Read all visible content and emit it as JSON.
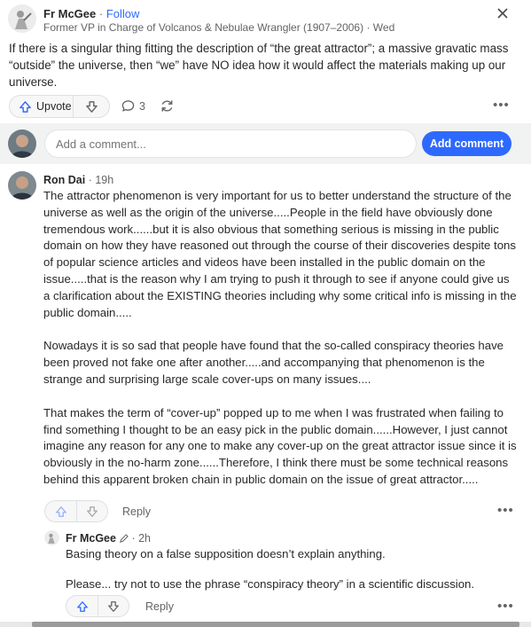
{
  "post": {
    "author": "Fr McGee",
    "follow_label": "Follow",
    "credential": "Former VP in Charge of Volcanos & Nebulae Wrangler (1907–2006)",
    "date": "Wed",
    "text": "If there is a singular thing fitting the description of “the great attractor”; a massive gravatic mass “outside” the universe, then “we” have NO idea how it would affect the materials making up our universe.",
    "upvote_label": "Upvote",
    "comment_count": "3"
  },
  "composer": {
    "placeholder": "Add a comment...",
    "button_label": "Add comment"
  },
  "comment": {
    "author": "Ron Dai",
    "time": "19h",
    "paragraphs": [
      "The attractor phenomenon is very important for us to better understand the structure of the universe as well as the origin of the universe.....People in the field have obviously done tremendous work......but it is also obvious that something serious is missing in the public domain on how they have reasoned out through the course of their discoveries despite tons of popular science articles and videos have been installed in the public domain on the issue.....that is the reason why I am trying to push it through to see if anyone could give us a clarification about the EXISTING theories including why some critical info is missing in the public domain.....",
      "Nowadays it is so sad that people have found that the so-called conspiracy theories have been proved not fake one after another.....and accompanying that phenomenon is the strange and surprising large scale cover-ups on many issues....",
      "That makes the term of “cover-up” popped up to me when I was frustrated when failing to find something I thought to be an easy pick in the public domain......However, I just cannot imagine any reason for any one to make any cover-up on the great attractor issue since it is obviously in the no-harm zone......Therefore, I think there must be some technical reasons behind this apparent broken chain in public domain on the issue of great attractor....."
    ],
    "reply_label": "Reply"
  },
  "reply": {
    "author": "Fr McGee",
    "time": "2h",
    "paragraphs": [
      "Basing theory on a false supposition doesn’t explain anything.",
      "Please... try not to use the phrase “conspiracy theory” in a scientific discussion."
    ],
    "reply_label": "Reply"
  },
  "colors": {
    "accent": "#2e69ff",
    "text": "#282829",
    "muted": "#636466",
    "border": "#dee0e1"
  }
}
